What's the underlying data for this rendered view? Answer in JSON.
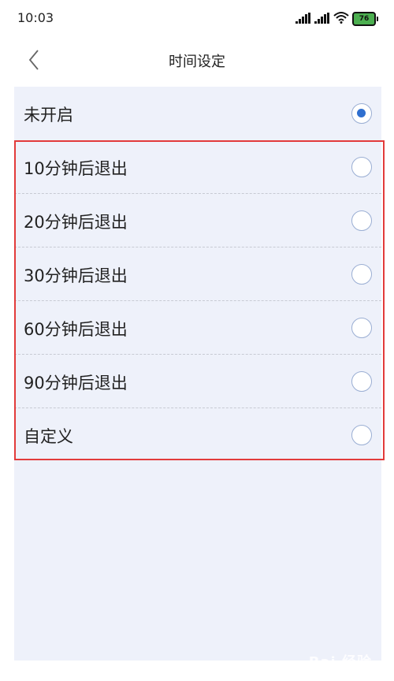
{
  "status": {
    "time": "10:03",
    "battery": "76",
    "icons": [
      "signal-icon",
      "signal-icon",
      "wifi-icon",
      "battery-icon"
    ]
  },
  "nav": {
    "title": "时间设定",
    "back_icon": "chevron-left-icon"
  },
  "options": [
    {
      "label": "未开启",
      "checked": true
    },
    {
      "label": "10分钟后退出",
      "checked": false
    },
    {
      "label": "20分钟后退出",
      "checked": false
    },
    {
      "label": "30分钟后退出",
      "checked": false
    },
    {
      "label": "60分钟后退出",
      "checked": false
    },
    {
      "label": "90分钟后退出",
      "checked": false
    },
    {
      "label": "自定义",
      "checked": false
    }
  ],
  "colors": {
    "radio_checked": "#2f6fcf",
    "radio_border": "#9aaed3",
    "panel_bg": "#eef1fa",
    "highlight": "#e23b3b"
  },
  "watermark": "Bai 经验"
}
